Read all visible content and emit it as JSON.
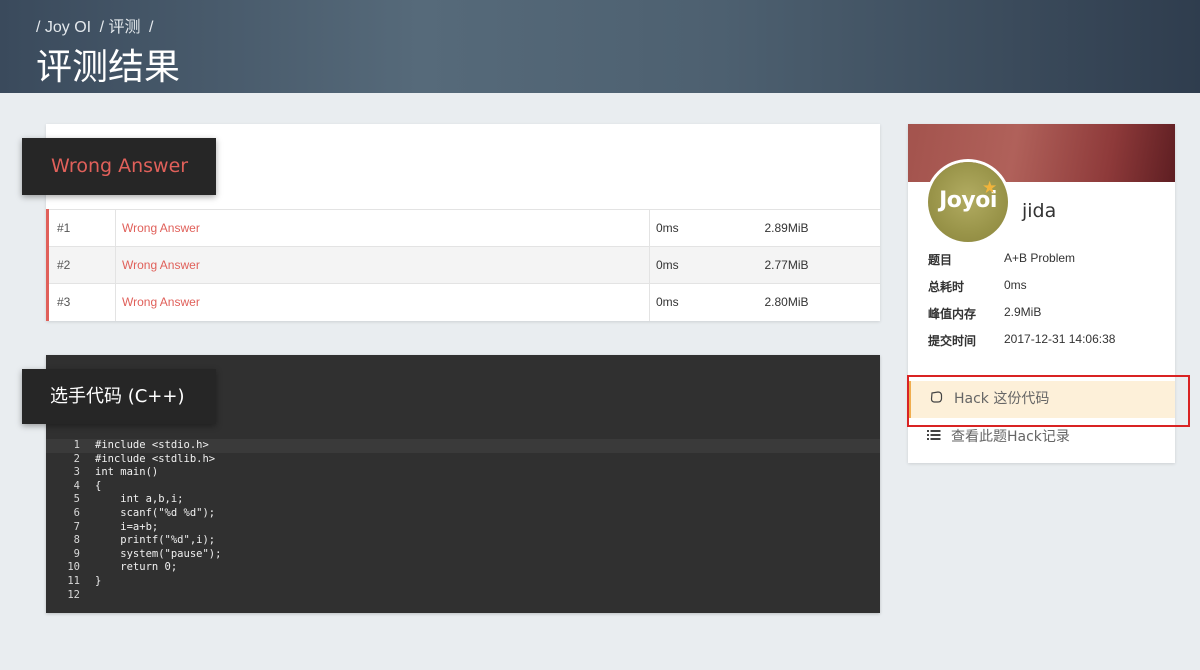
{
  "header": {
    "breadcrumb": [
      "/ Joy OI",
      "/ 评测",
      "/"
    ],
    "title": "评测结果"
  },
  "result": {
    "label": "Wrong Answer",
    "rows": [
      {
        "idx": "#1",
        "status": "Wrong Answer",
        "time": "0ms",
        "memory": "2.89MiB"
      },
      {
        "idx": "#2",
        "status": "Wrong Answer",
        "time": "0ms",
        "memory": "2.77MiB"
      },
      {
        "idx": "#3",
        "status": "Wrong Answer",
        "time": "0ms",
        "memory": "2.80MiB"
      }
    ]
  },
  "code": {
    "label": "选手代码 (C++)",
    "lines": [
      {
        "n": "1",
        "text": "#include <stdio.h>"
      },
      {
        "n": "2",
        "text": "#include <stdlib.h>"
      },
      {
        "n": "3",
        "text": "int main()"
      },
      {
        "n": "4",
        "text": "{"
      },
      {
        "n": "5",
        "text": "    int a,b,i;"
      },
      {
        "n": "6",
        "text": "    scanf(\"%d %d\");"
      },
      {
        "n": "7",
        "text": "    i=a+b;"
      },
      {
        "n": "8",
        "text": "    printf(\"%d\",i);"
      },
      {
        "n": "9",
        "text": "    system(\"pause\");"
      },
      {
        "n": "10",
        "text": "    return 0;"
      },
      {
        "n": "11",
        "text": "}"
      },
      {
        "n": "12",
        "text": ""
      }
    ]
  },
  "sidebar": {
    "avatar_text": "Joyoi",
    "username": "jida",
    "info": [
      {
        "key": "题目",
        "value": "A+B Problem"
      },
      {
        "key": "总耗时",
        "value": "0ms"
      },
      {
        "key": "峰值内存",
        "value": "2.9MiB"
      },
      {
        "key": "提交时间",
        "value": "2017-12-31 14:06:38"
      }
    ],
    "hack_label": "Hack 这份代码",
    "history_label": "查看此题Hack记录"
  },
  "colors": {
    "wrong": "#e0605a",
    "hack_bg": "#fdf0d9",
    "highlight": "#d92323"
  },
  "icons": {
    "hack": "hand-icon",
    "history": "list-icon",
    "avatar_badge": "star-icon"
  }
}
